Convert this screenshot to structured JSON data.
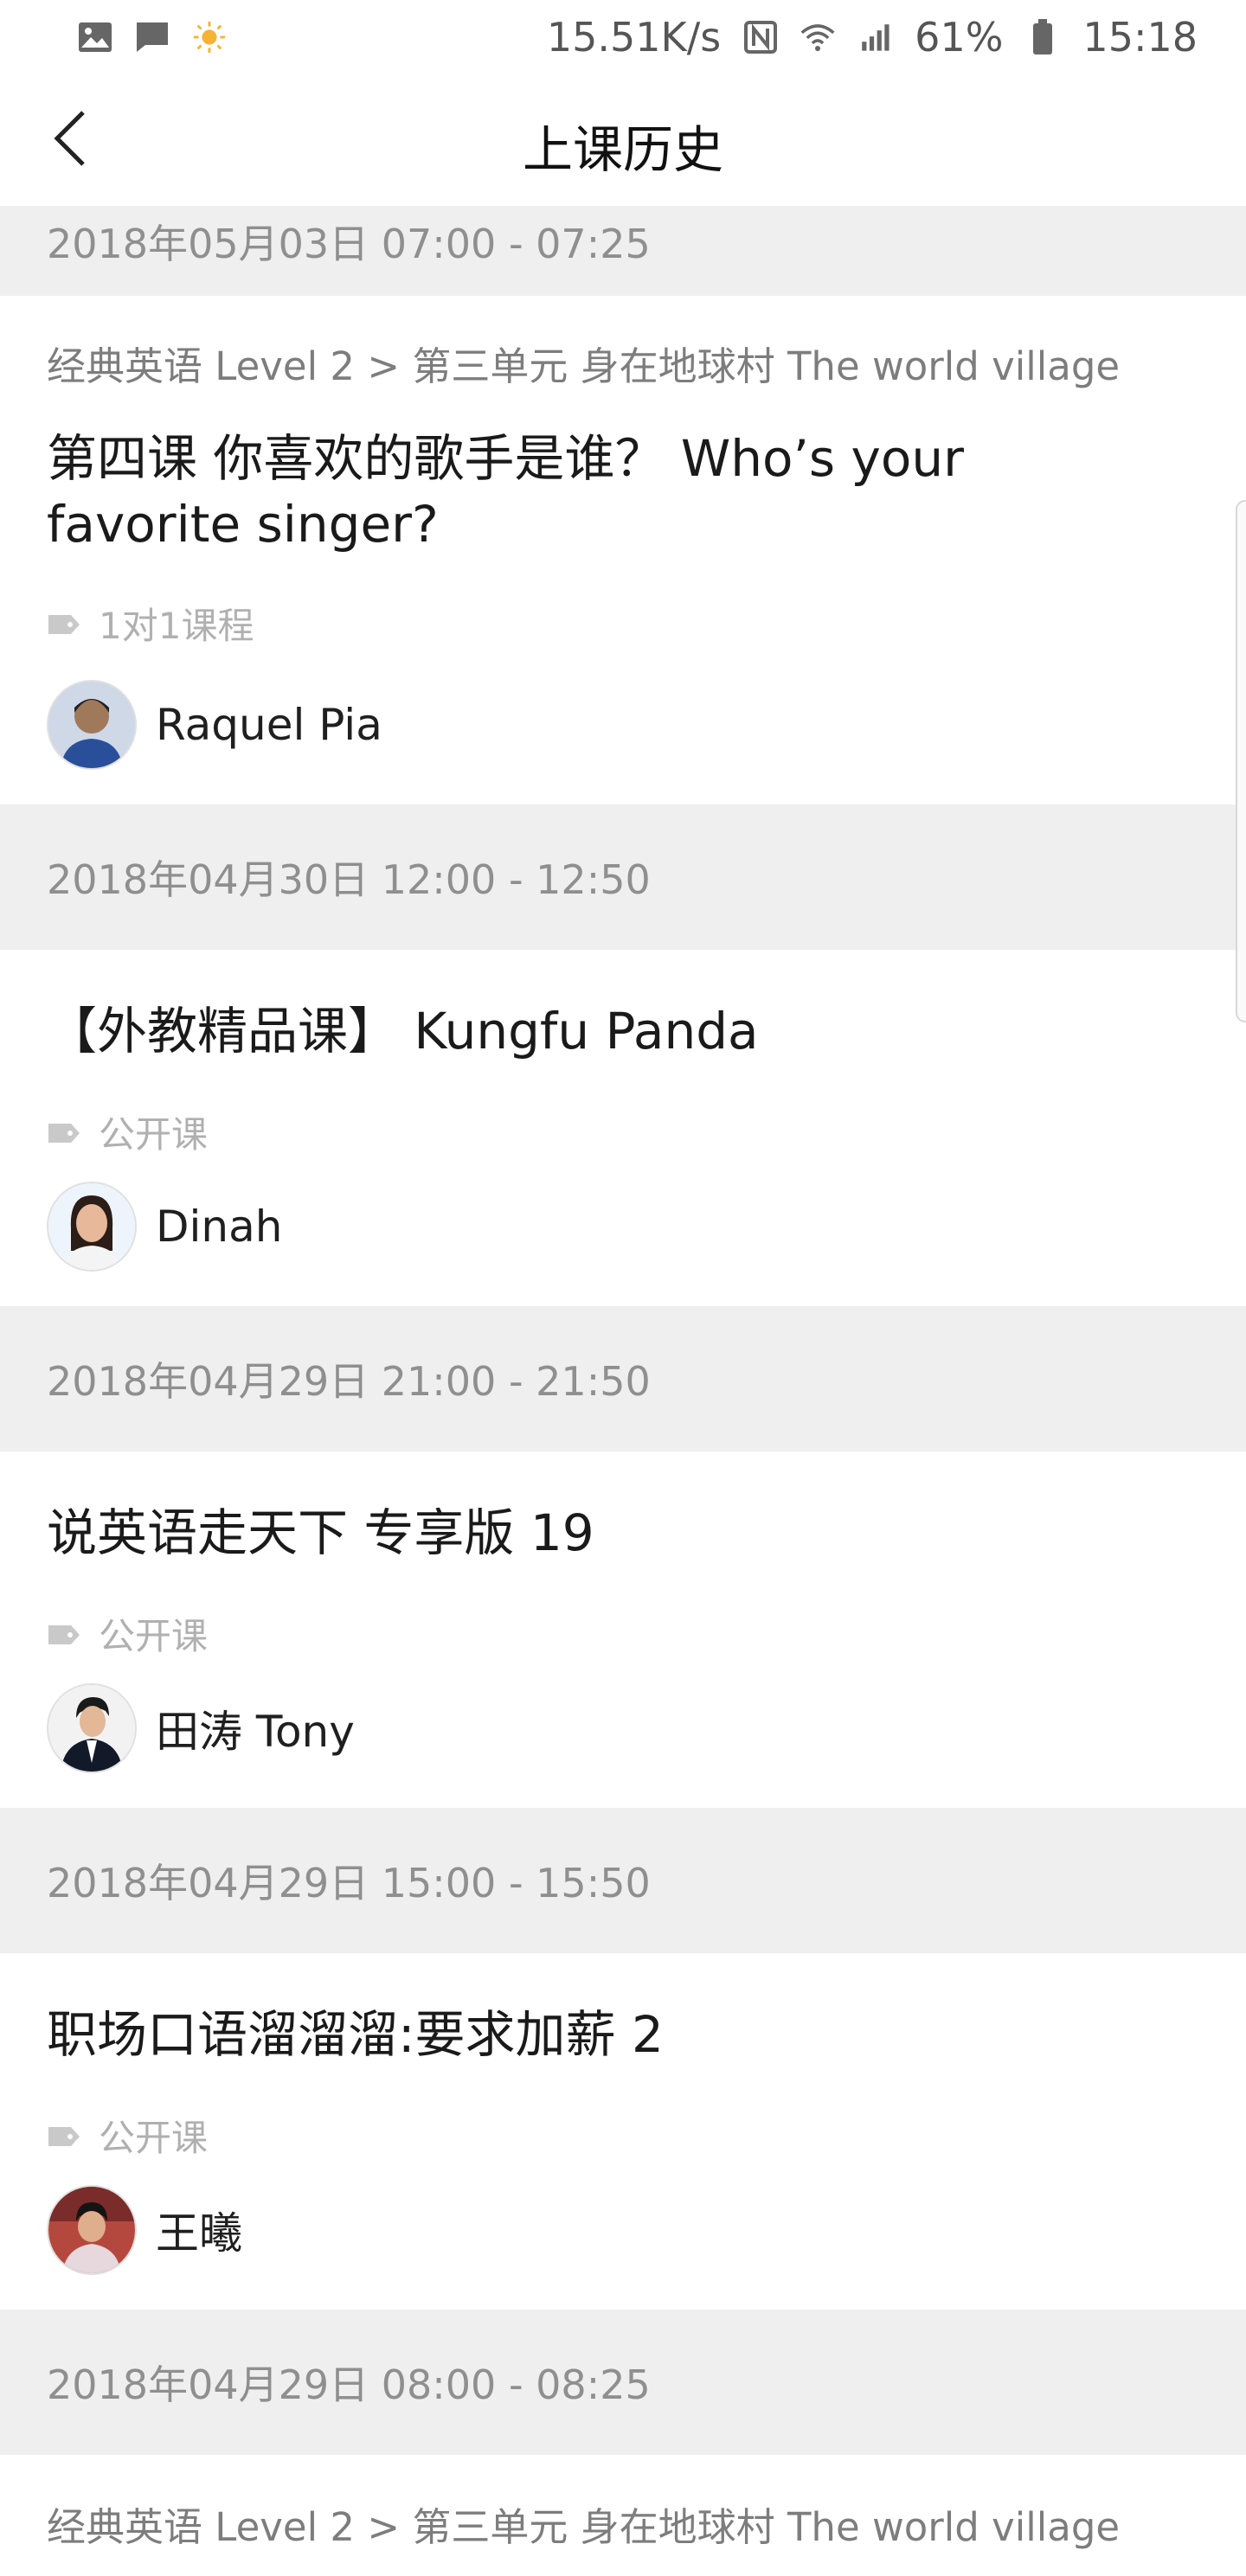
{
  "status_bar": {
    "left_icons": [
      "image-icon",
      "message-icon",
      "sun-icon"
    ],
    "network_speed": "15.51K/s",
    "battery_percent": "61%",
    "time": "15:18"
  },
  "header": {
    "title": "上课历史"
  },
  "items": [
    {
      "date": "2018年05月03日 07:00 - 07:25",
      "breadcrumb": "经典英语 Level 2 > 第三单元 身在地球村 The world village",
      "title": "第四课 你喜欢的歌手是谁？ Who’s your favorite singer?",
      "tag": "1对1课程",
      "teacher": "Raquel Pia"
    },
    {
      "date": "2018年04月30日 12:00 - 12:50",
      "breadcrumb": "",
      "title": "【外教精品课】 Kungfu Panda",
      "tag": "公开课",
      "teacher": "Dinah"
    },
    {
      "date": "2018年04月29日 21:00 - 21:50",
      "breadcrumb": "",
      "title": "说英语走天下 专享版 19",
      "tag": "公开课",
      "teacher": "田涛 Tony"
    },
    {
      "date": "2018年04月29日 15:00 - 15:50",
      "breadcrumb": "",
      "title": "职场口语溜溜溜:要求加薪 2",
      "tag": "公开课",
      "teacher": "王曦"
    },
    {
      "date": "2018年04月29日 08:00 - 08:25",
      "breadcrumb": "经典英语 Level 2 > 第三单元 身在地球村 The world village",
      "title": "",
      "tag": "",
      "teacher": ""
    }
  ]
}
